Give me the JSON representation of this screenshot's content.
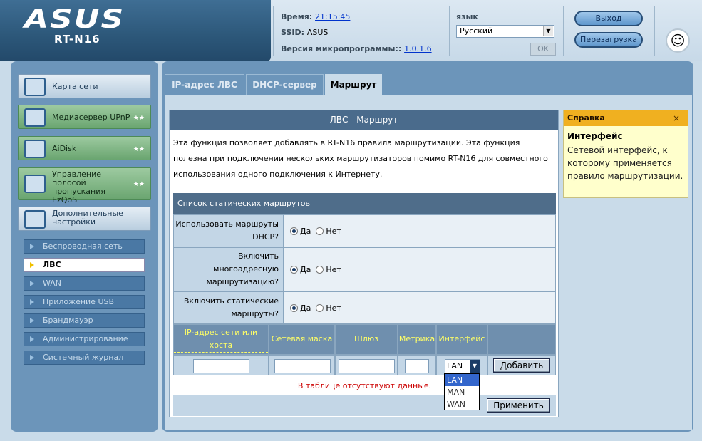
{
  "brand": {
    "logo": "ASUS",
    "model": "RT-N16"
  },
  "header": {
    "time_label": "Время:",
    "time_value": "21:15:45",
    "ssid_label": "SSID:",
    "ssid_value": "ASUS",
    "fw_label": "Версия микропрограммы::",
    "fw_value": "1.0.1.6",
    "lang_label": "язык",
    "lang_value": "Русский",
    "ok_label": "OK",
    "logout_label": "Выход",
    "reboot_label": "Перезагрузка"
  },
  "sidebar": {
    "menus": [
      {
        "label": "Карта сети",
        "icon": "network-map-icon"
      },
      {
        "label": "Медиасервер UPnP",
        "icon": "media-server-icon"
      },
      {
        "label": "AiDisk",
        "icon": "aidisk-icon"
      },
      {
        "label": "Управление полосой пропускания EzQoS",
        "icon": "qos-icon"
      },
      {
        "label": "Дополнительные настройки",
        "icon": "advanced-settings-icon"
      }
    ],
    "stars": "★★",
    "submenu": [
      "Беспроводная сеть",
      "ЛВС",
      "WAN",
      "Приложение USB",
      "Брандмауэр",
      "Администрирование",
      "Системный журнал"
    ]
  },
  "tabs": [
    "IP-адрес ЛВС",
    "DHCP-сервер",
    "Маршрут"
  ],
  "panel": {
    "title": "ЛВС - Маршрут",
    "description": "Эта функция позволяет добавлять в RT-N16 правила маршрутизации. Эта функция полезна при подключении нескольких маршрутизаторов помимо RT-N16 для совместного использования одного подключения к Интернету.",
    "list_title": "Список статических маршрутов",
    "rows": [
      {
        "label": "Использовать маршруты DHCP?",
        "yes": "Да",
        "no": "Нет",
        "value": "yes"
      },
      {
        "label": "Включить многоадресную маршрутизацию?",
        "yes": "Да",
        "no": "Нет",
        "value": "yes"
      },
      {
        "label": "Включить статические маршруты?",
        "yes": "Да",
        "no": "Нет",
        "value": "yes"
      }
    ],
    "columns": [
      "IP-адрес сети или хоста",
      "Сетевая маска",
      "Шлюз",
      "Метрика",
      "Интерфейс"
    ],
    "iface_value": "LAN",
    "iface_options": [
      "LAN",
      "MAN",
      "WAN"
    ],
    "add_label": "Добавить",
    "nodata": "В таблице отсутствуют данные.",
    "apply_label": "Применить"
  },
  "help": {
    "bar": "Справка",
    "close": "×",
    "title": "Интерфейс",
    "text": "Сетевой интерфейс, к которому применяется правило маршрутизации."
  }
}
